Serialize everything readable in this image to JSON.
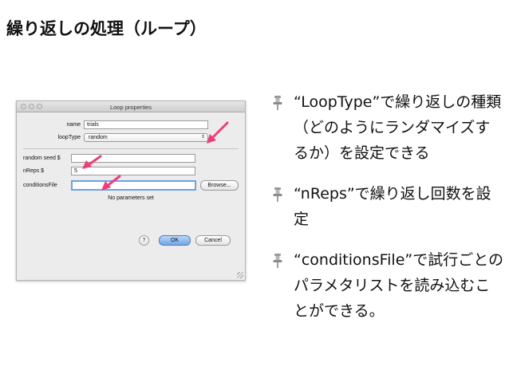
{
  "slide": {
    "title": "繰り返しの処理（ループ）"
  },
  "dialog": {
    "title": "Loop properties",
    "fields": {
      "name": {
        "label": "name",
        "value": "trials"
      },
      "loop_type": {
        "label": "loopType",
        "value": "random"
      },
      "random_seed": {
        "label": "random seed $",
        "value": ""
      },
      "n_reps": {
        "label": "nReps $",
        "value": "5"
      },
      "conditions_file": {
        "label": "conditionsFile",
        "value": ""
      }
    },
    "browse_label": "Browse...",
    "no_params_text": "No parameters set",
    "help_label": "?",
    "ok_label": "OK",
    "cancel_label": "Cancel"
  },
  "bullets": [
    {
      "text": "“LoopType”で繰り返しの種類（どのようにランダマイズするか）を設定できる"
    },
    {
      "text": "“nReps”で繰り返し回数を設定"
    },
    {
      "text": "“conditionsFile”で試行ごとのパラメタリストを読み込むことができる。"
    }
  ],
  "icons": {
    "bullet": "pushpin-icon",
    "annotation": "pink-arrow-icon"
  },
  "colors": {
    "arrow": "#ec3f7a",
    "ok_button": "#6fa6e8",
    "focus_ring": "#6aa2e6"
  }
}
